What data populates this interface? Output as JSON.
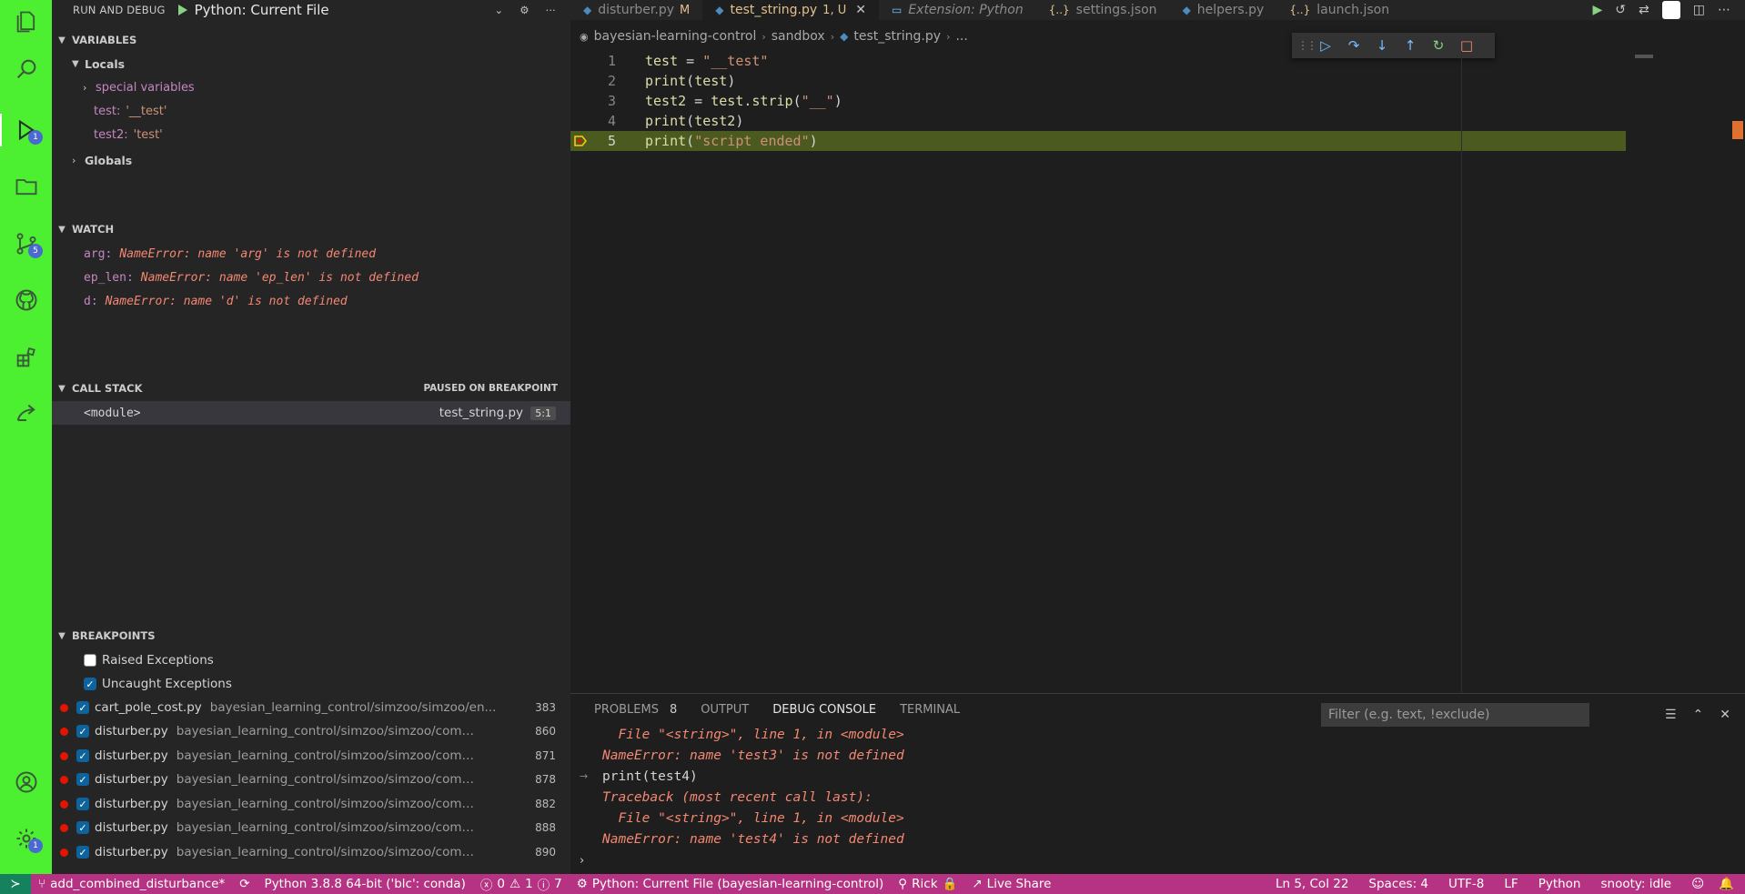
{
  "run_debug": {
    "title": "RUN AND DEBUG",
    "config": "Python: Current File"
  },
  "variables": {
    "header": "VARIABLES",
    "locals": "Locals",
    "special": "special variables",
    "items": [
      {
        "name": "test:",
        "value": "'__test'"
      },
      {
        "name": "test2:",
        "value": "'test'"
      }
    ],
    "globals": "Globals"
  },
  "watch": {
    "header": "WATCH",
    "items": [
      {
        "name": "arg:",
        "error": "NameError: name 'arg' is not defined"
      },
      {
        "name": "ep_len:",
        "error": "NameError: name 'ep_len' is not defined"
      },
      {
        "name": "d:",
        "error": "NameError: name 'd' is not defined"
      }
    ]
  },
  "callstack": {
    "header": "CALL STACK",
    "status": "PAUSED ON BREAKPOINT",
    "frame": {
      "name": "<module>",
      "file": "test_string.py",
      "pos": "5:1"
    }
  },
  "breakpoints": {
    "header": "BREAKPOINTS",
    "raised": "Raised Exceptions",
    "uncaught": "Uncaught Exceptions",
    "items": [
      {
        "file": "cart_pole_cost.py",
        "path": "bayesian_learning_control/simzoo/simzoo/en...",
        "line": "383"
      },
      {
        "file": "disturber.py",
        "path": "bayesian_learning_control/simzoo/simzoo/common",
        "line": "860"
      },
      {
        "file": "disturber.py",
        "path": "bayesian_learning_control/simzoo/simzoo/common",
        "line": "871"
      },
      {
        "file": "disturber.py",
        "path": "bayesian_learning_control/simzoo/simzoo/common",
        "line": "878"
      },
      {
        "file": "disturber.py",
        "path": "bayesian_learning_control/simzoo/simzoo/common",
        "line": "882"
      },
      {
        "file": "disturber.py",
        "path": "bayesian_learning_control/simzoo/simzoo/common",
        "line": "888"
      },
      {
        "file": "disturber.py",
        "path": "bayesian_learning_control/simzoo/simzoo/common",
        "line": "890"
      }
    ]
  },
  "activity_badges": {
    "debug": "1",
    "scm": "5",
    "accounts": "1"
  },
  "tabs": [
    {
      "label": "disturber.py",
      "mod": "M",
      "icon": "python-file-icon"
    },
    {
      "label": "test_string.py",
      "mod": "1, U",
      "icon": "python-file-icon"
    },
    {
      "label": "Extension: Python",
      "icon": "extension-file-icon"
    },
    {
      "label": "settings.json",
      "icon": "json-file-icon"
    },
    {
      "label": "helpers.py",
      "icon": "python-file-icon"
    },
    {
      "label": "launch.json",
      "icon": "json-file-icon"
    }
  ],
  "breadcrumb": {
    "root": "bayesian-learning-control",
    "folder": "sandbox",
    "file": "test_string.py",
    "more": "..."
  },
  "code": {
    "lines": [
      {
        "n": "1"
      },
      {
        "n": "2"
      },
      {
        "n": "3"
      },
      {
        "n": "4"
      },
      {
        "n": "5"
      }
    ]
  },
  "panel": {
    "tabs": {
      "problems": "PROBLEMS",
      "problems_count": "8",
      "output": "OUTPUT",
      "debug": "DEBUG CONSOLE",
      "terminal": "TERMINAL"
    },
    "filter_placeholder": "Filter (e.g. text, !exclude)",
    "lines": [
      "  File \"<string>\", line 1, in <module>",
      "NameError: name 'test3' is not defined",
      "print(test4)",
      "Traceback (most recent call last):",
      "  File \"<string>\", line 1, in <module>",
      "NameError: name 'test4' is not defined"
    ]
  },
  "status": {
    "branch": "add_combined_disturbance*",
    "python": "Python 3.8.8 64-bit ('blc': conda)",
    "errors": "0",
    "warnings": "1",
    "info": "7",
    "debug": "Python: Current File (bayesian-learning-control)",
    "user": "Rick",
    "liveshare": "Live Share",
    "position": "Ln 5, Col 22",
    "spaces": "Spaces: 4",
    "encoding": "UTF-8",
    "eol": "LF",
    "lang": "Python",
    "snooty": "snooty: idle"
  }
}
